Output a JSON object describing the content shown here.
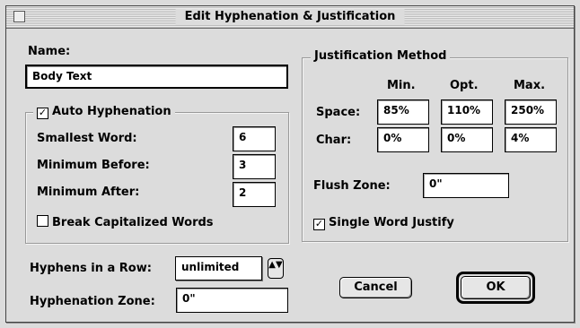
{
  "window": {
    "title": "Edit Hyphenation & Justification"
  },
  "name_section": {
    "label": "Name:",
    "value": "Body Text"
  },
  "auto_hyphenation": {
    "label": "Auto Hyphenation",
    "checked": true,
    "smallest_word": {
      "label": "Smallest Word:",
      "value": "6"
    },
    "minimum_before": {
      "label": "Minimum Before:",
      "value": "3"
    },
    "minimum_after": {
      "label": "Minimum After:",
      "value": "2"
    },
    "break_capitalized": {
      "label": "Break Capitalized Words",
      "checked": false
    }
  },
  "justification": {
    "title": "Justification Method",
    "col_min": "Min.",
    "col_opt": "Opt.",
    "col_max": "Max.",
    "space": {
      "label": "Space:",
      "min": "85%",
      "opt": "110%",
      "max": "250%"
    },
    "char": {
      "label": "Char:",
      "min": "0%",
      "opt": "0%",
      "max": "4%"
    },
    "flush_zone": {
      "label": "Flush Zone:",
      "value": "0\""
    },
    "single_word": {
      "label": "Single Word Justify",
      "checked": true
    }
  },
  "hyphens_in_row": {
    "label": "Hyphens in a Row:",
    "value": "unlimited"
  },
  "hyphenation_zone": {
    "label": "Hyphenation Zone:",
    "value": "0\""
  },
  "buttons": {
    "cancel": "Cancel",
    "ok": "OK"
  },
  "glyphs": {
    "check": "✓",
    "updown": "▲▼"
  }
}
